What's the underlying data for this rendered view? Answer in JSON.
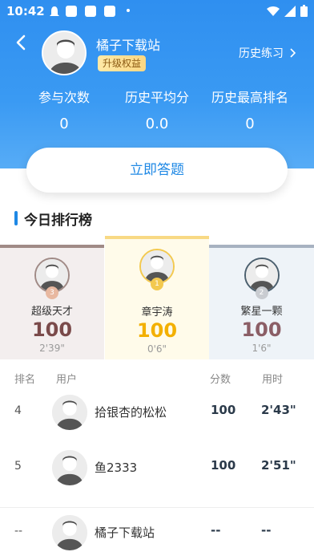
{
  "status": {
    "time": "10:42"
  },
  "profile": {
    "username": "橘子下载站",
    "upgrade_badge": "升级权益",
    "history_link": "历史练习"
  },
  "stats": [
    {
      "label": "参与次数",
      "value": "0"
    },
    {
      "label": "历史平均分",
      "value": "0.0"
    },
    {
      "label": "历史最高排名",
      "value": "0"
    }
  ],
  "cta": {
    "label": "立即答题"
  },
  "section": {
    "title": "今日排行榜"
  },
  "podium": {
    "first": {
      "rank": "1",
      "name": "章宇涛",
      "score": "100",
      "time": "0'6\""
    },
    "second": {
      "rank": "2",
      "name": "繁星一颗",
      "score": "100",
      "time": "1'6\""
    },
    "third": {
      "rank": "3",
      "name": "超级天才",
      "score": "100",
      "time": "2'39\""
    }
  },
  "table": {
    "headers": {
      "rank": "排名",
      "user": "用户",
      "score": "分数",
      "time": "用时"
    },
    "rows": [
      {
        "rank": "4",
        "name": "拾银杏的松松",
        "score": "100",
        "time": "2'43\""
      },
      {
        "rank": "5",
        "name": "鱼2333",
        "score": "100",
        "time": "2'51\""
      }
    ],
    "self_row": {
      "rank": "--",
      "name": "橘子下载站",
      "score": "--",
      "time": "--"
    }
  },
  "colors": {
    "header_blue": "#3a9af3",
    "accent_blue": "#1e88e5",
    "gold": "#f3b000",
    "silver_score": "#8b5e66",
    "bronze_score": "#7a4a4a"
  }
}
